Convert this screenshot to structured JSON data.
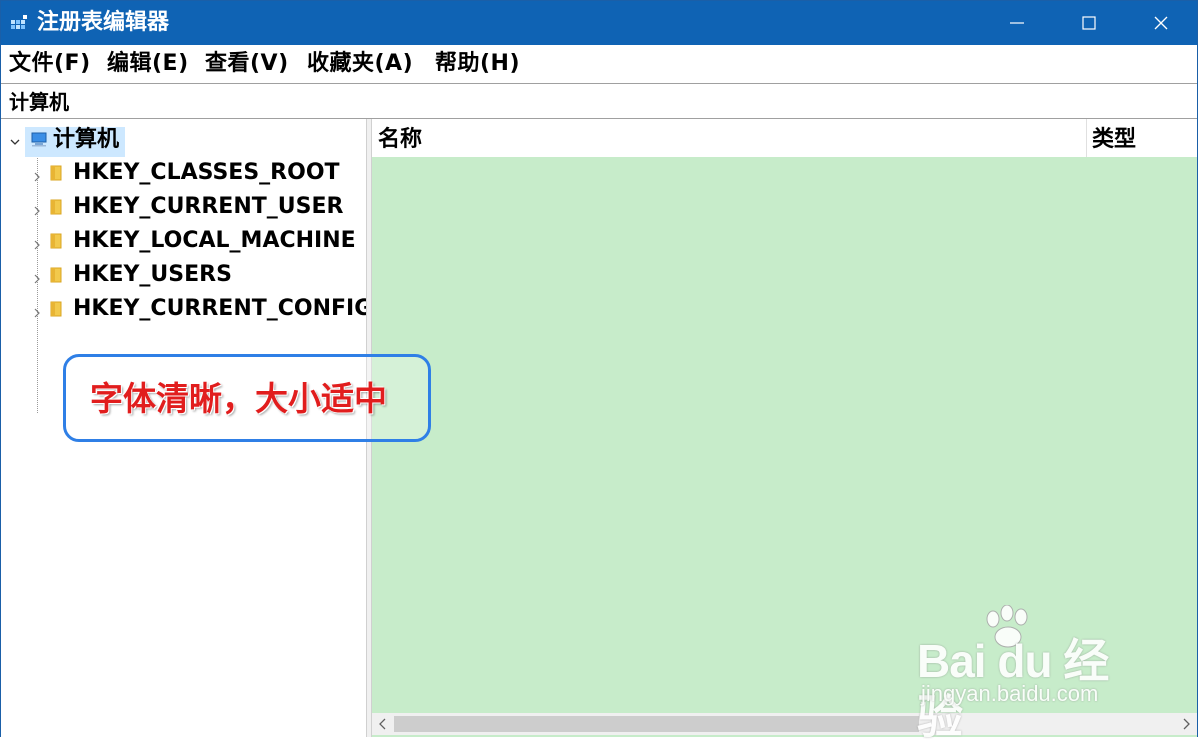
{
  "window": {
    "title": "注册表编辑器"
  },
  "menu": [
    {
      "label": "文件(F)",
      "name": "menu-file"
    },
    {
      "label": "编辑(E)",
      "name": "menu-edit"
    },
    {
      "label": "查看(V)",
      "name": "menu-view"
    },
    {
      "label": "收藏夹(A)",
      "name": "menu-favorites"
    },
    {
      "label": "帮助(H)",
      "name": "menu-help"
    }
  ],
  "address": {
    "path": "计算机"
  },
  "tree": {
    "root": {
      "label": "计算机",
      "icon": "computer-icon",
      "expanded": true,
      "selected": true
    },
    "items": [
      {
        "label": "HKEY_CLASSES_ROOT",
        "icon": "folder-icon"
      },
      {
        "label": "HKEY_CURRENT_USER",
        "icon": "folder-icon"
      },
      {
        "label": "HKEY_LOCAL_MACHINE",
        "icon": "folder-icon"
      },
      {
        "label": "HKEY_USERS",
        "icon": "folder-icon"
      },
      {
        "label": "HKEY_CURRENT_CONFIG",
        "icon": "folder-icon"
      }
    ]
  },
  "values_pane": {
    "columns": [
      "名称",
      "类型"
    ],
    "background": "#c7ecca"
  },
  "callout": {
    "text": "字体清晰，大小适中",
    "color": "#e11d1d",
    "border_color": "#2f7fe6"
  },
  "watermark": {
    "logo": "Bai du 经验",
    "url": "jingyan.baidu.com"
  },
  "colors": {
    "titlebar": "#0f63b4",
    "selection": "#cde8ff"
  }
}
